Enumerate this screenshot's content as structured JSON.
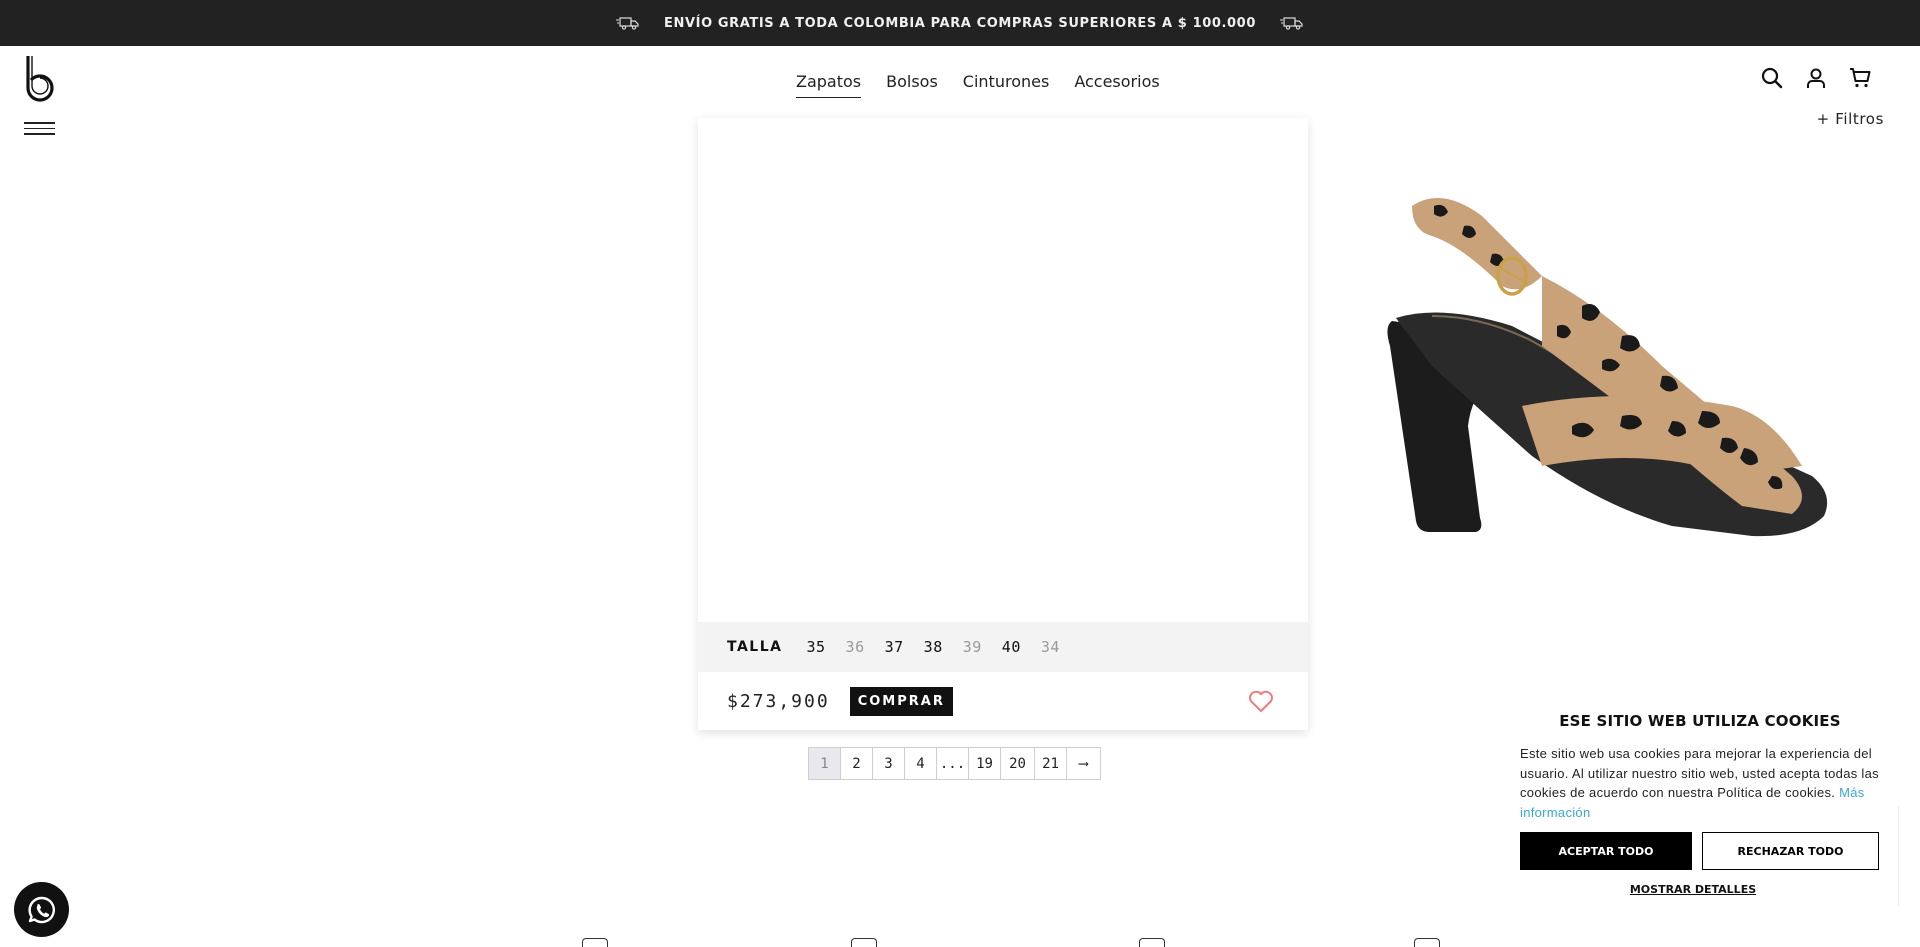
{
  "topbar": {
    "message": "ENVÍO GRATIS A TODA COLOMBIA PARA COMPRAS SUPERIORES A $ 100.000",
    "left_icon": "truck-icon",
    "right_icon": "truck-icon"
  },
  "header": {
    "logo": "b",
    "nav": [
      {
        "label": "Zapatos",
        "active": true
      },
      {
        "label": "Bolsos",
        "active": false
      },
      {
        "label": "Cinturones",
        "active": false
      },
      {
        "label": "Accesorios",
        "active": false
      }
    ],
    "icons": [
      "search-icon",
      "user-icon",
      "cart-icon"
    ],
    "filters_label": "+ Filtros"
  },
  "product_card": {
    "sizes_label": "TALLA",
    "sizes": [
      {
        "value": "35",
        "available": true
      },
      {
        "value": "36",
        "available": false
      },
      {
        "value": "37",
        "available": true
      },
      {
        "value": "38",
        "available": true
      },
      {
        "value": "39",
        "available": false
      },
      {
        "value": "40",
        "available": true
      },
      {
        "value": "34",
        "available": false
      }
    ],
    "price": "$273,900",
    "buy_label": "COMPRAR",
    "wishlist_icon": "heart-icon"
  },
  "pagination": {
    "pages": [
      "1",
      "2",
      "3",
      "4",
      "...",
      "19",
      "20",
      "21",
      "⟶"
    ],
    "current": "1"
  },
  "cookie_banner": {
    "title": "ESE SITIO WEB UTILIZA COOKIES",
    "body": "Este sitio web usa cookies para mejorar la experiencia del usuario. Al utilizar nuestro sitio web, usted acepta todas las cookies de acuerdo con nuestra Política de cookies.",
    "more_link": "Más información",
    "accept_label": "ACEPTAR TODO",
    "reject_label": "RECHAZAR TODO",
    "details_label": "MOSTRAR DETALLES"
  },
  "colors": {
    "topbar_bg": "#222222",
    "accent_heart": "#f07c7c",
    "link": "#3aa7d8"
  }
}
